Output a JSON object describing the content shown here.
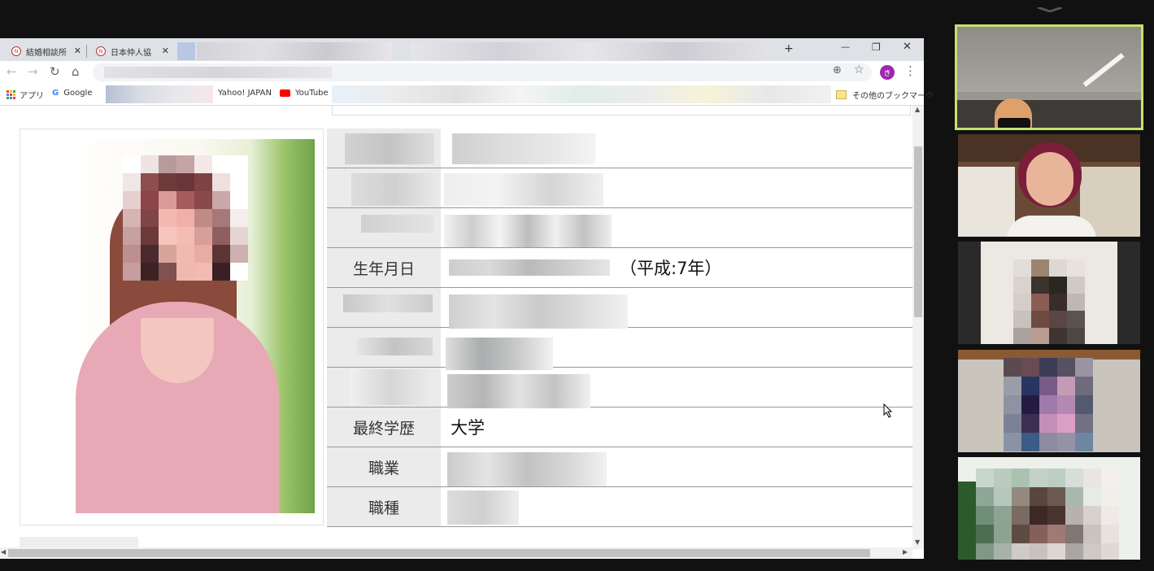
{
  "browser": {
    "tabs": [
      {
        "title": "結婚相談所",
        "close": "✕"
      },
      {
        "title": "日本仲人協",
        "close": "✕"
      }
    ],
    "new_tab": "+",
    "window_controls": {
      "minimize": "—",
      "maximize": "❐",
      "close": "✕"
    },
    "avatar_letter": "き",
    "bookmarks": {
      "apps": "アプリ",
      "google": "Google",
      "yahoo": "Yahoo! JAPAN",
      "youtube": "YouTube",
      "other": "その他のブックマーク"
    }
  },
  "profile": {
    "rows": [
      {
        "label": "",
        "value": ""
      },
      {
        "label": "",
        "value": ""
      },
      {
        "label": "",
        "value": ""
      },
      {
        "label": "生年月日",
        "value": "（平成:7年）"
      },
      {
        "label": "",
        "value": ""
      },
      {
        "label": "",
        "value": ""
      },
      {
        "label": "",
        "value": ""
      },
      {
        "label": "最終学歴",
        "value": "大学"
      },
      {
        "label": "職業",
        "value": ""
      },
      {
        "label": "職種",
        "value": ""
      }
    ]
  },
  "colors": {
    "active_speaker": "#c6e36b",
    "avatar": "#9c27b0"
  }
}
